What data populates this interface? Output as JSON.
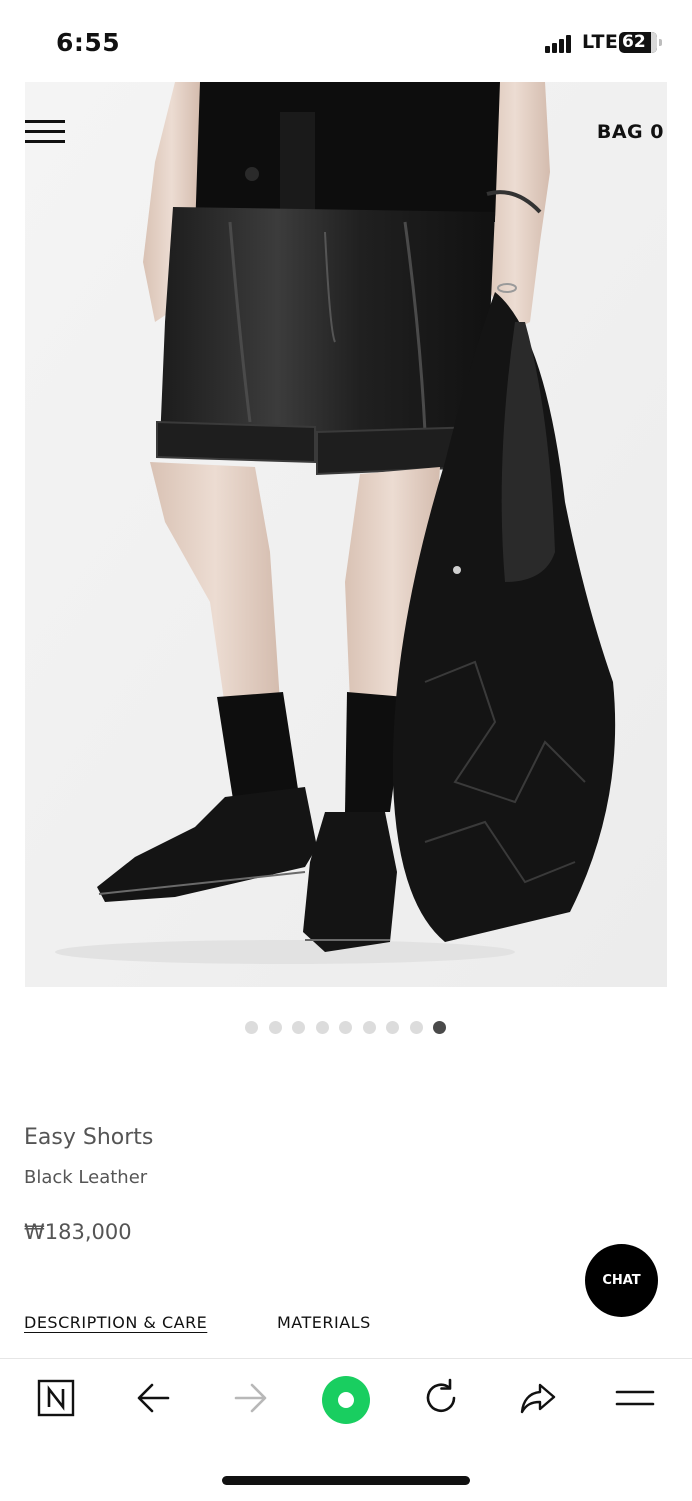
{
  "status_bar": {
    "time": "6:55",
    "network": "LTE",
    "battery": "62"
  },
  "header": {
    "bag_label": "BAG 0",
    "menu_icon": "hamburger-menu-icon"
  },
  "carousel": {
    "total_slides": 9,
    "active_slide": 9
  },
  "product": {
    "name": "Easy Shorts",
    "color": "Black Leather",
    "price": "₩183,000"
  },
  "chat": {
    "label": "CHAT"
  },
  "tabs": [
    {
      "label": "DESCRIPTION & CARE",
      "active": true
    },
    {
      "label": "MATERIALS",
      "active": false
    }
  ],
  "browser_toolbar": {
    "icons": [
      "naver-n-icon",
      "back-arrow-icon",
      "forward-arrow-icon",
      "naver-green-circle-icon",
      "reload-icon",
      "share-icon",
      "more-menu-icon"
    ],
    "accent_color": "#19ce60"
  }
}
